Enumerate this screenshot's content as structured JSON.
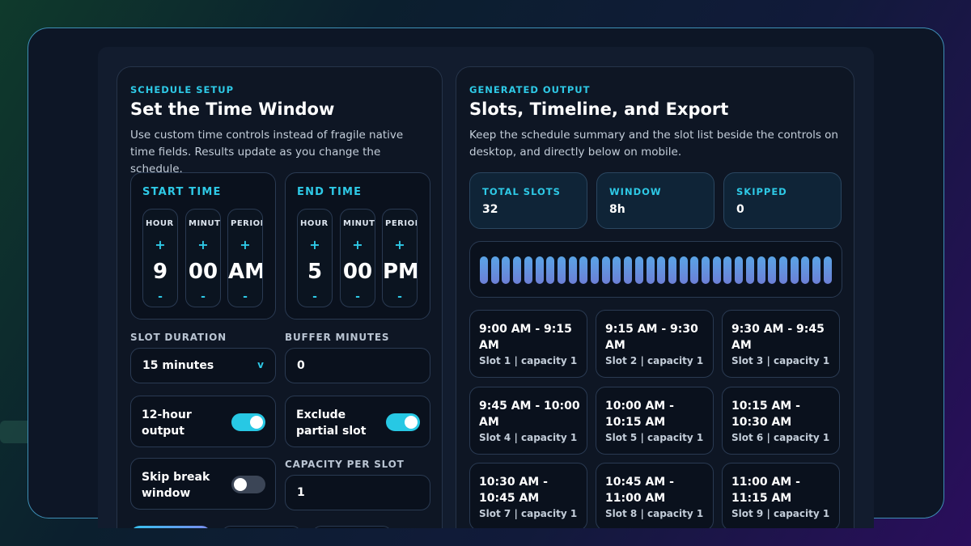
{
  "setup": {
    "eyebrow": "SCHEDULE SETUP",
    "title": "Set the Time Window",
    "description": "Use custom time controls instead of fragile native time fields. Results update as you change the schedule.",
    "start": {
      "label": "START TIME",
      "hour_label": "HOUR",
      "minute_label": "MINUTE",
      "period_label": "PERIOD",
      "hour": "9",
      "minute": "00",
      "period": "AM"
    },
    "end": {
      "label": "END TIME",
      "hour_label": "HOUR",
      "minute_label": "MINUTE",
      "period_label": "PERIOD",
      "hour": "5",
      "minute": "00",
      "period": "PM"
    },
    "plus": "+",
    "minus": "-",
    "slot_duration": {
      "label": "SLOT DURATION",
      "value": "15 minutes",
      "chevron": "v"
    },
    "buffer": {
      "label": "BUFFER MINUTES",
      "value": "0"
    },
    "toggle_12h": {
      "label": "12-hour output",
      "on": true
    },
    "toggle_partial": {
      "label": "Exclude partial slot",
      "on": true
    },
    "toggle_break": {
      "label": "Skip break window",
      "on": false
    },
    "capacity": {
      "label": "CAPACITY PER SLOT",
      "value": "1"
    }
  },
  "output": {
    "eyebrow": "GENERATED OUTPUT",
    "title": "Slots, Timeline, and Export",
    "description": "Keep the schedule summary and the slot list beside the controls on desktop, and directly below on mobile.",
    "stats": [
      {
        "label": "TOTAL SLOTS",
        "value": "32"
      },
      {
        "label": "WINDOW",
        "value": "8h"
      },
      {
        "label": "SKIPPED",
        "value": "0"
      }
    ],
    "timeline_bar_count": 32,
    "slots": [
      {
        "time": "9:00 AM - 9:15 AM",
        "meta": "Slot 1 | capacity 1"
      },
      {
        "time": "9:15 AM - 9:30 AM",
        "meta": "Slot 2 | capacity 1"
      },
      {
        "time": "9:30 AM - 9:45 AM",
        "meta": "Slot 3 | capacity 1"
      },
      {
        "time": "9:45 AM - 10:00 AM",
        "meta": "Slot 4 | capacity 1"
      },
      {
        "time": "10:00 AM - 10:15 AM",
        "meta": "Slot 5 | capacity 1"
      },
      {
        "time": "10:15 AM - 10:30 AM",
        "meta": "Slot 6 | capacity 1"
      },
      {
        "time": "10:30 AM - 10:45 AM",
        "meta": "Slot 7 | capacity 1"
      },
      {
        "time": "10:45 AM - 11:00 AM",
        "meta": "Slot 8 | capacity 1"
      },
      {
        "time": "11:00 AM - 11:15 AM",
        "meta": "Slot 9 | capacity 1"
      }
    ]
  },
  "colors": {
    "accent": "#2ec9e6",
    "toggle_on": "#27c8e4",
    "bar_top": "#5aa4e6",
    "bar_bottom": "#6c7fd6"
  }
}
